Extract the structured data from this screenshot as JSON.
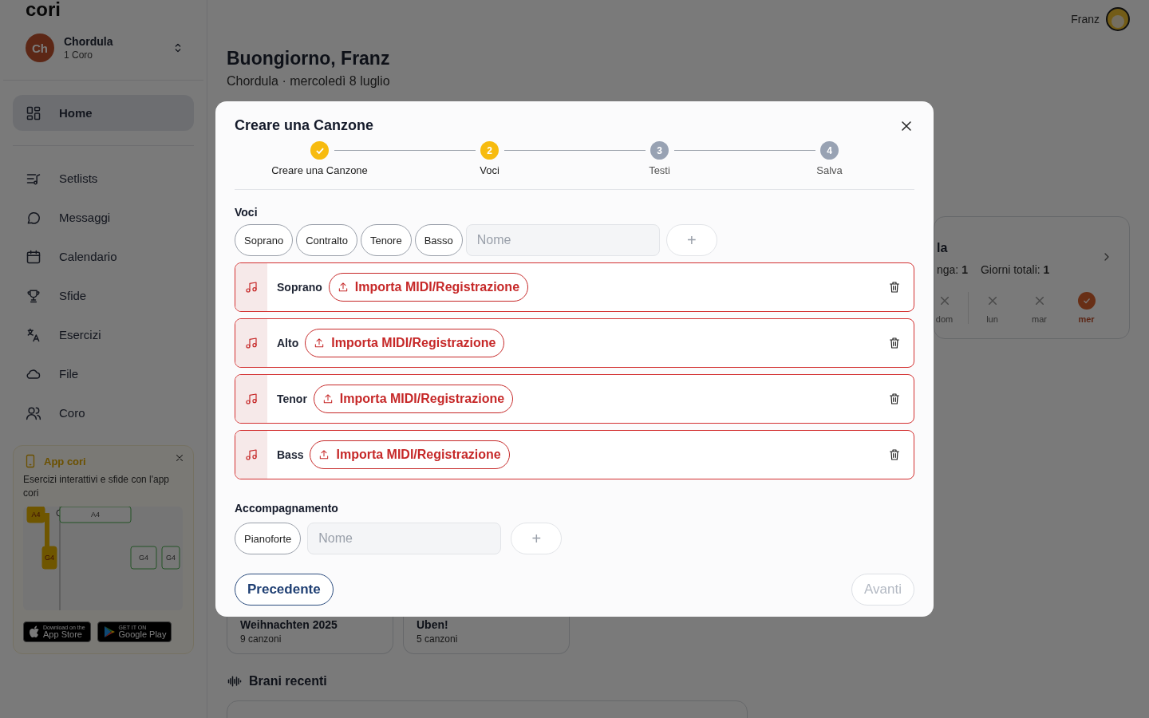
{
  "sidebar": {
    "logo": "cori",
    "workspace": {
      "initials": "Ch",
      "name": "Chordula",
      "subtitle": "1 Coro"
    },
    "nav": [
      {
        "label": "Home",
        "selected": true
      },
      {
        "label": "Setlists",
        "selected": false
      },
      {
        "label": "Messaggi",
        "selected": false
      },
      {
        "label": "Calendario",
        "selected": false
      },
      {
        "label": "Sfide",
        "selected": false
      },
      {
        "label": "Esercizi",
        "selected": false
      },
      {
        "label": "File",
        "selected": false
      },
      {
        "label": "Coro",
        "selected": false
      }
    ],
    "promo": {
      "title": "App cori",
      "text": "Esercizi interattivi e sfide con l'app cori",
      "preview_notes": [
        {
          "label": "A4",
          "kind": "sung"
        },
        {
          "label": "A4",
          "kind": "target"
        },
        {
          "label": "G4",
          "kind": "sung"
        },
        {
          "label": "G4",
          "kind": "target"
        },
        {
          "label": "G4",
          "kind": "target"
        }
      ],
      "badges": [
        {
          "kind": "apple",
          "small": "Download on the",
          "big": "App Store"
        },
        {
          "kind": "google",
          "small": "GET IT ON",
          "big": "Google Play"
        }
      ]
    }
  },
  "header": {
    "user": "Franz"
  },
  "greeting": {
    "title": "Buongiorno, Franz",
    "subtitle": "Chordula · mercoledì 8 luglio"
  },
  "streak": {
    "title": "la",
    "stats": [
      "nga: **1**",
      "Giorni totali: **1**"
    ],
    "days": [
      {
        "label": "dom",
        "done": false
      },
      {
        "label": "lun",
        "done": false
      },
      {
        "label": "mar",
        "done": false
      },
      {
        "label": "mer",
        "done": true
      }
    ]
  },
  "setlists": [
    {
      "title": "Weihnachten 2025",
      "count": "9 canzoni"
    },
    {
      "title": "Uben!",
      "count": "5 canzoni"
    }
  ],
  "recent": {
    "title": "Brani recenti"
  },
  "dialog": {
    "title": "Creare una Canzone",
    "steps": [
      {
        "label": "Creare una Canzone",
        "kind": "done"
      },
      {
        "label": "Voci",
        "number": "2",
        "kind": "current"
      },
      {
        "label": "Testi",
        "number": "3",
        "kind": "pending"
      },
      {
        "label": "Salva",
        "number": "4",
        "kind": "pending"
      }
    ],
    "voices_title": "Voci",
    "voice_presets": [
      "Soprano",
      "Contralto",
      "Tenore",
      "Basso"
    ],
    "voice_name": {
      "placeholder": "Nome"
    },
    "add_label": "+",
    "voices": [
      {
        "name": "Soprano",
        "action": "Importa MIDI/Registrazione"
      },
      {
        "name": "Alto",
        "action": "Importa MIDI/Registrazione"
      },
      {
        "name": "Tenor",
        "action": "Importa MIDI/Registrazione"
      },
      {
        "name": "Bass",
        "action": "Importa MIDI/Registrazione"
      }
    ],
    "accompaniment_title": "Accompagnamento",
    "accompaniment_presets": [
      "Pianoforte"
    ],
    "accompaniment_name": {
      "placeholder": "Nome"
    },
    "accompaniment_add_label": "+",
    "back": {
      "label": "Precedente",
      "disabled": false
    },
    "next": {
      "label": "Avanti",
      "disabled": true
    }
  }
}
